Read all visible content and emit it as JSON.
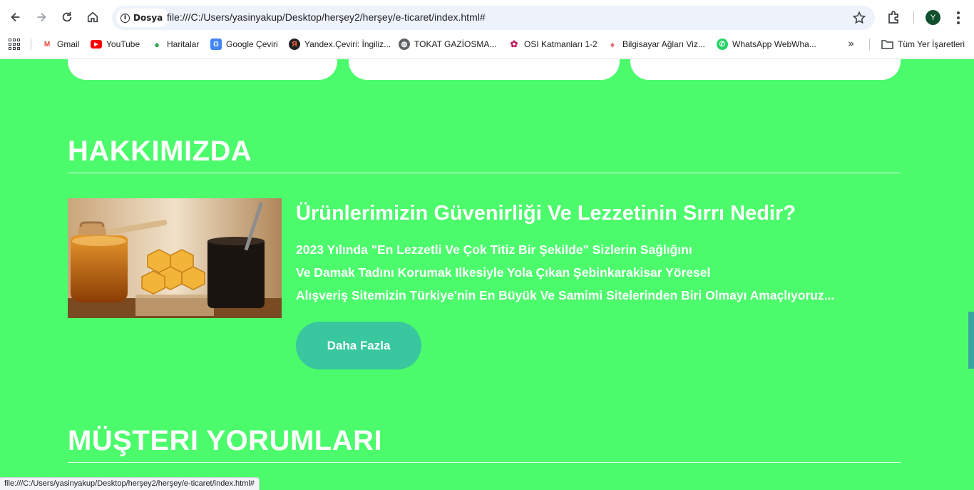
{
  "browser": {
    "site_chip": "Dosya",
    "url": "file:///C:/Users/yasinyakup/Desktop/herşey2/herşey/e-ticaret/index.html#",
    "profile_initial": "Y",
    "bookmarks": [
      {
        "label": "Gmail",
        "icon": "gmail-icon",
        "color": "#ea4335"
      },
      {
        "label": "YouTube",
        "icon": "youtube-icon",
        "color": "#ff0000"
      },
      {
        "label": "Haritalar",
        "icon": "maps-icon",
        "color": "#34a853"
      },
      {
        "label": "Google Çeviri",
        "icon": "translate-icon",
        "color": "#4285f4"
      },
      {
        "label": "Yandex.Çeviri: İngiliz...",
        "icon": "yandex-icon",
        "color": "#d9382c"
      },
      {
        "label": "TOKAT GAZİOSMA...",
        "icon": "globe-icon",
        "color": "#5f6368"
      },
      {
        "label": "OSI Katmanları 1-2",
        "icon": "osi-icon",
        "color": "#c2185b"
      },
      {
        "label": "Bilgisayar Ağları Viz...",
        "icon": "network-icon",
        "color": "#e57373"
      },
      {
        "label": "WhatsApp WebWha...",
        "icon": "whatsapp-icon",
        "color": "#25d366"
      }
    ],
    "all_bookmarks_label": "Tüm Yer İşaretleri",
    "status_url": "file:///C:/Users/yasinyakup/Desktop/herşey2/herşey/e-ticaret/index.html#"
  },
  "page": {
    "colors": {
      "background": "#4cfb6c",
      "button": "#38c79e",
      "text": "#ffffff"
    },
    "about": {
      "title": "HAKKIMIZDA",
      "image": "honey-jar-image",
      "heading": "Ürünlerimizin Güvenirliği Ve Lezzetinin Sırrı Nedir?",
      "lines": [
        "2023 Yılında \"En Lezzetli Ve Çok Titiz Bir Şekilde\" Sizlerin Sağlığını",
        "Ve Damak Tadını Korumak Ilkesiyle Yola Çıkan Şebinkarakisar Yöresel",
        "Alışveriş Sitemizin Türkiye'nin En Büyük Ve Samimi Sitelerinden Biri Olmayı Amaçlıyoruz..."
      ],
      "button_label": "Daha Fazla"
    },
    "reviews": {
      "title": "MÜŞTERI YORUMLARI"
    }
  }
}
